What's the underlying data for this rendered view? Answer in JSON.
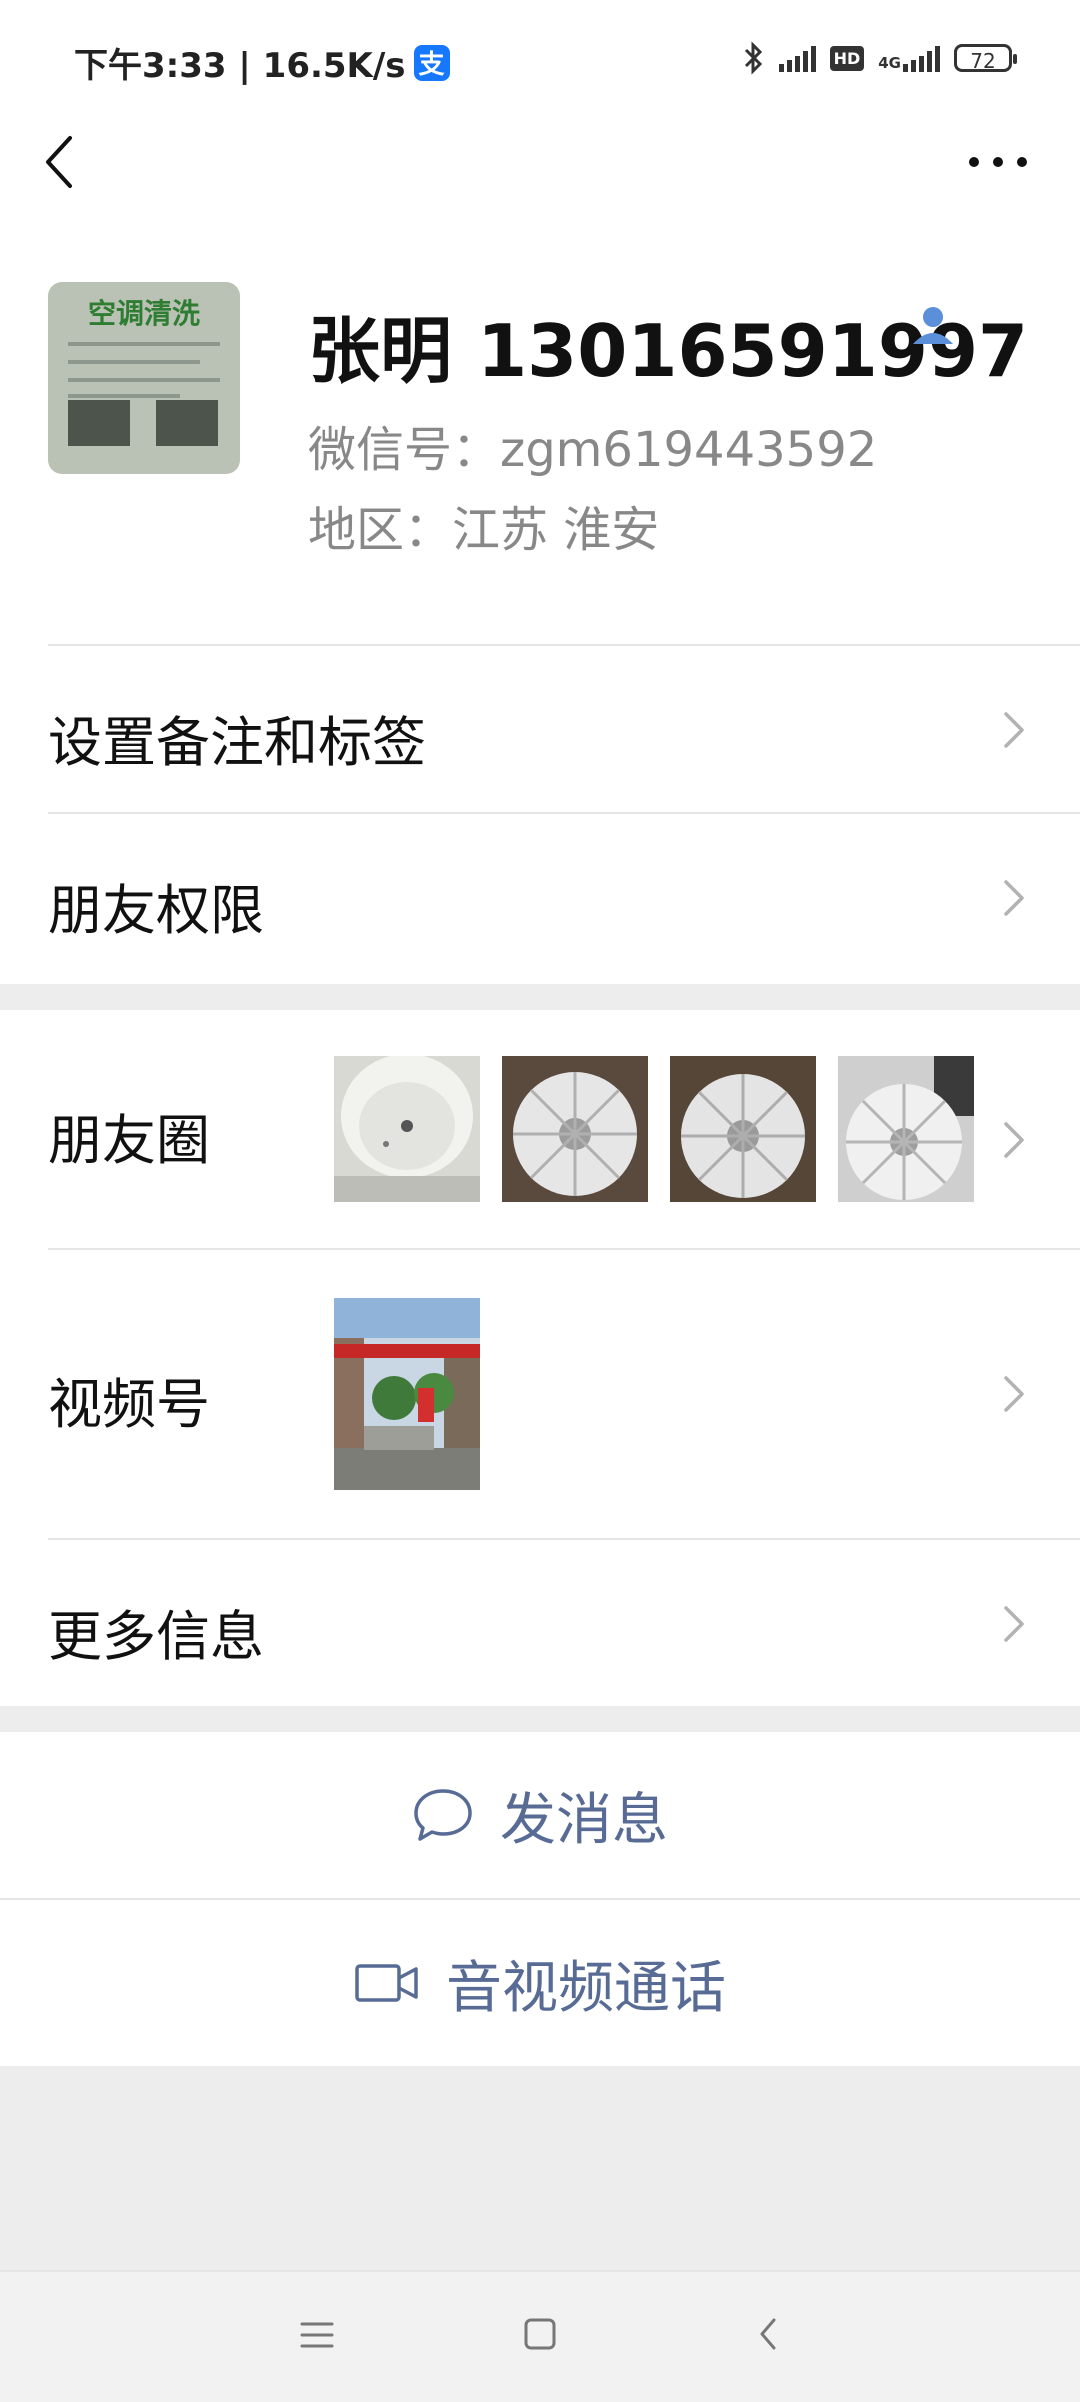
{
  "status_bar": {
    "time_speed": "下午3:33 | 16.5K/s",
    "alipay_glyph": "支",
    "hd": "HD",
    "network": "4G",
    "battery": "72"
  },
  "profile": {
    "avatar_text": "空调清洗",
    "name": "张明 13016591997",
    "wechat_id": "微信号：zgm619443592",
    "region": "地区：江苏  淮安"
  },
  "menu": {
    "set_remark": "设置备注和标签",
    "friend_permissions": "朋友权限",
    "moments": "朋友圈",
    "channels": "视频号",
    "more_info": "更多信息"
  },
  "actions": {
    "send_message": "发消息",
    "av_call": "音视频通话"
  },
  "colors": {
    "link_blue": "#576b95",
    "contact_icon": "#5b8fd9",
    "alipay_blue": "#1677ff"
  },
  "icons": [
    "back-icon",
    "more-icon",
    "contact-icon",
    "chevron-right-icon",
    "chat-bubble-icon",
    "video-camera-icon",
    "nav-menu-icon",
    "nav-home-icon",
    "nav-back-icon"
  ]
}
